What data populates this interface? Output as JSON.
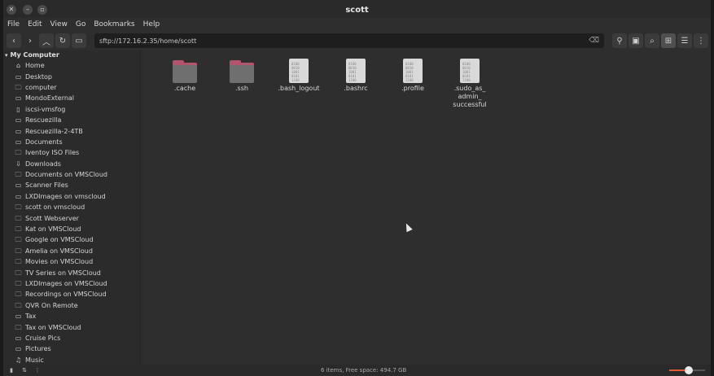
{
  "window": {
    "title": "scott"
  },
  "menu": [
    "File",
    "Edit",
    "View",
    "Go",
    "Bookmarks",
    "Help"
  ],
  "toolbar": {
    "location": "sftp://172.16.2.35/home/scott",
    "nav_icons": [
      "back-icon",
      "forward-icon",
      "up-icon",
      "reload-icon",
      "computer-icon"
    ],
    "right_icons": [
      "location-pin-icon",
      "terminal-icon",
      "search-icon",
      "icon-view-icon",
      "list-view-icon",
      "compact-view-icon"
    ]
  },
  "sidebar": {
    "header": "My Computer",
    "items": [
      {
        "label": "Home",
        "icon": "home-icon"
      },
      {
        "label": "Desktop",
        "icon": "desktop-icon"
      },
      {
        "label": "computer",
        "icon": "network-folder-icon"
      },
      {
        "label": "MondoExternal",
        "icon": "folder-icon"
      },
      {
        "label": "iscsi-vmsfog",
        "icon": "drive-icon"
      },
      {
        "label": "Rescuezilla",
        "icon": "folder-icon"
      },
      {
        "label": "Rescuezilla-2-4TB",
        "icon": "folder-icon"
      },
      {
        "label": "Documents",
        "icon": "folder-icon"
      },
      {
        "label": "Iventoy ISO Files",
        "icon": "network-folder-icon"
      },
      {
        "label": "Downloads",
        "icon": "download-icon"
      },
      {
        "label": "Documents on VMSCloud",
        "icon": "network-folder-icon"
      },
      {
        "label": "Scanner Files",
        "icon": "folder-icon"
      },
      {
        "label": "LXDImages on vmscloud",
        "icon": "folder-icon"
      },
      {
        "label": "scott on vmscloud",
        "icon": "network-folder-icon"
      },
      {
        "label": "Scott Webserver",
        "icon": "network-folder-icon"
      },
      {
        "label": "Kat on VMSCloud",
        "icon": "network-folder-icon"
      },
      {
        "label": "Google on VMSCloud",
        "icon": "network-folder-icon"
      },
      {
        "label": "Amelia on VMSCloud",
        "icon": "network-folder-icon"
      },
      {
        "label": "Movies on VMSCloud",
        "icon": "network-folder-icon"
      },
      {
        "label": "TV Series on VMSCloud",
        "icon": "network-folder-icon"
      },
      {
        "label": "LXDImages on VMSCloud",
        "icon": "network-folder-icon"
      },
      {
        "label": "Recordings on VMSCloud",
        "icon": "network-folder-icon"
      },
      {
        "label": "QVR On Remote",
        "icon": "network-folder-icon"
      },
      {
        "label": "Tax",
        "icon": "folder-icon"
      },
      {
        "label": "Tax on VMSCloud",
        "icon": "network-folder-icon"
      },
      {
        "label": "Cruise Pics",
        "icon": "folder-icon"
      },
      {
        "label": "Pictures",
        "icon": "folder-icon"
      },
      {
        "label": "Music",
        "icon": "music-icon"
      }
    ]
  },
  "files": [
    {
      "name": ".cache",
      "type": "folder"
    },
    {
      "name": ".ssh",
      "type": "folder"
    },
    {
      "name": ".bash_logout",
      "type": "file"
    },
    {
      "name": ".bashrc",
      "type": "file"
    },
    {
      "name": ".profile",
      "type": "file"
    },
    {
      "name": ".sudo_as_admin_successful",
      "type": "file",
      "display_lines": [
        ".sudo_as_",
        "admin_",
        "successful"
      ]
    }
  ],
  "status": {
    "text": "6 items, Free space: 494.7 GB",
    "zoom_level": 0.55
  },
  "colors": {
    "folder_accent": "#b0556b",
    "zoom_accent": "#e05a3a"
  }
}
